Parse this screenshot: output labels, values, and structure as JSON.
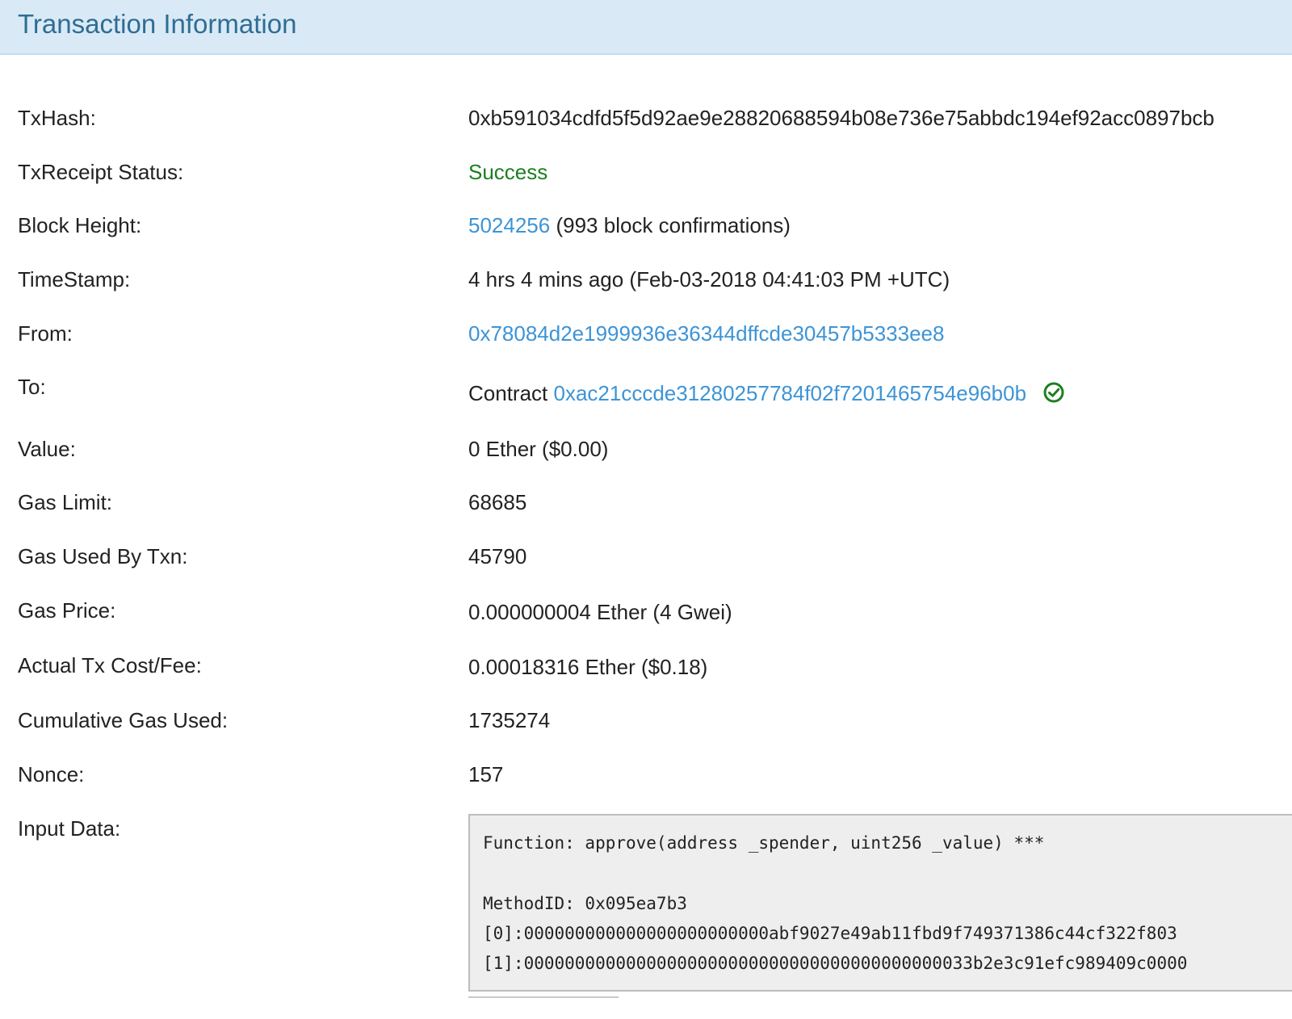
{
  "panel": {
    "title": "Transaction Information"
  },
  "rows": {
    "txhash": {
      "label": "TxHash:",
      "value": "0xb591034cdfd5f5d92ae9e28820688594b08e736e75abbdc194ef92acc0897bcb"
    },
    "status": {
      "label": "TxReceipt Status:",
      "value": "Success"
    },
    "block_height": {
      "label": "Block Height:",
      "block": "5024256",
      "confirmations": "(993 block confirmations)"
    },
    "timestamp": {
      "label": "TimeStamp:",
      "value": "4 hrs 4 mins ago (Feb-03-2018 04:41:03 PM +UTC)"
    },
    "from": {
      "label": "From:",
      "value": "0x78084d2e1999936e36344dffcde30457b5333ee8"
    },
    "to": {
      "label": "To:",
      "prefix": "Contract",
      "address": "0xac21cccde31280257784f02f7201465754e96b0b"
    },
    "value": {
      "label": "Value:",
      "value": "0 Ether ($0.00)"
    },
    "gas_limit": {
      "label": "Gas Limit:",
      "value": "68685"
    },
    "gas_used": {
      "label": "Gas Used By Txn:",
      "value": "45790"
    },
    "gas_price": {
      "label": "Gas Price:",
      "value": "0.000000004 Ether (4 Gwei)"
    },
    "fee": {
      "label": "Actual Tx Cost/Fee:",
      "value": "0.00018316 Ether ($0.18)"
    },
    "cumulative_gas": {
      "label": "Cumulative Gas Used:",
      "value": "1735274"
    },
    "nonce": {
      "label": "Nonce:",
      "value": "157"
    },
    "input_data": {
      "label": "Input Data:",
      "function": "Function: approve(address _spender, uint256 _value) ***",
      "method_id": "MethodID: 0x095ea7b3",
      "param_0": "[0]:000000000000000000000000abf9027e49ab11fbd9f749371386c44cf322f803",
      "param_1": "[1]:00000000000000000000000000000000000000000033b2e3c91efc989409c0000"
    }
  },
  "colors": {
    "header_bg": "#d9eaf6",
    "title": "#2f6d93",
    "link": "#3d94d6",
    "success": "#1d7f21"
  },
  "icons": {
    "verified": "check-circle-icon"
  }
}
